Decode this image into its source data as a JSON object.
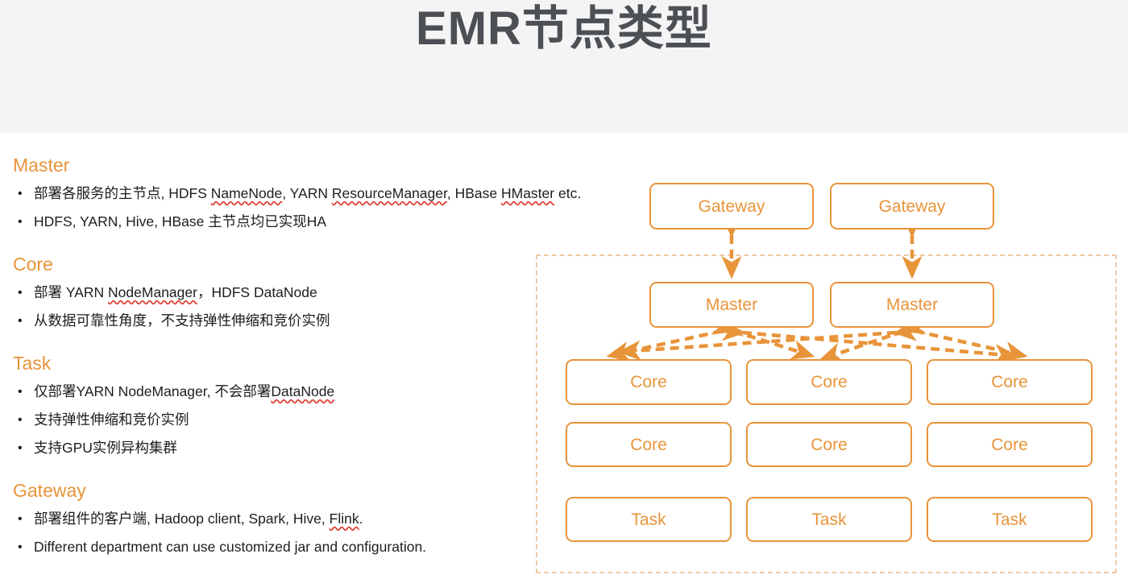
{
  "header": {
    "title": "EMR节点类型",
    "background": "#f4f4f5",
    "title_color": "#4c5055"
  },
  "theme": {
    "accent": "#e8943a",
    "accent_light": "#edc9a4",
    "body_text": "#1d1d1d",
    "spellcheck_underline": "#e03b2f"
  },
  "sections": [
    {
      "heading": "Master",
      "bullets": [
        {
          "parts": [
            {
              "text": "部署各服务的主节点, HDFS ",
              "misspelled": false
            },
            {
              "text": "NameNode",
              "misspelled": true
            },
            {
              "text": ", YARN ",
              "misspelled": false
            },
            {
              "text": "ResourceManager",
              "misspelled": true
            },
            {
              "text": ", HBase ",
              "misspelled": false
            },
            {
              "text": "HMaster",
              "misspelled": true
            },
            {
              "text": " etc.",
              "misspelled": false
            }
          ]
        },
        {
          "parts": [
            {
              "text": "HDFS, YARN, Hive, HBase 主节点均已实现HA",
              "misspelled": false
            }
          ]
        }
      ]
    },
    {
      "heading": "Core",
      "bullets": [
        {
          "parts": [
            {
              "text": "部署 YARN ",
              "misspelled": false
            },
            {
              "text": "NodeManager",
              "misspelled": true
            },
            {
              "text": "，HDFS DataNode",
              "misspelled": false
            }
          ]
        },
        {
          "parts": [
            {
              "text": "从数据可靠性角度，不支持弹性伸缩和竞价实例",
              "misspelled": false
            }
          ]
        }
      ]
    },
    {
      "heading": "Task",
      "bullets": [
        {
          "parts": [
            {
              "text": "仅部署YARN NodeManager, 不会部署",
              "misspelled": false
            },
            {
              "text": "DataNode",
              "misspelled": true
            }
          ]
        },
        {
          "parts": [
            {
              "text": "支持弹性伸缩和竞价实例",
              "misspelled": false
            }
          ]
        },
        {
          "parts": [
            {
              "text": "支持GPU实例异构集群",
              "misspelled": false
            }
          ]
        }
      ]
    },
    {
      "heading": "Gateway",
      "bullets": [
        {
          "parts": [
            {
              "text": "部署组件的客户端, Hadoop client, Spark, Hive, ",
              "misspelled": false
            },
            {
              "text": "Flink",
              "misspelled": true
            },
            {
              "text": ".",
              "misspelled": false
            }
          ]
        },
        {
          "parts": [
            {
              "text": "Different department can use customized jar and configuration.",
              "misspelled": false
            }
          ]
        }
      ]
    }
  ],
  "diagram": {
    "cluster_label": "",
    "nodes": {
      "gateway_1": "Gateway",
      "gateway_2": "Gateway",
      "master_1": "Master",
      "master_2": "Master",
      "core_1": "Core",
      "core_2": "Core",
      "core_3": "Core",
      "core_4": "Core",
      "core_5": "Core",
      "core_6": "Core",
      "task_1": "Task",
      "task_2": "Task",
      "task_3": "Task"
    }
  }
}
